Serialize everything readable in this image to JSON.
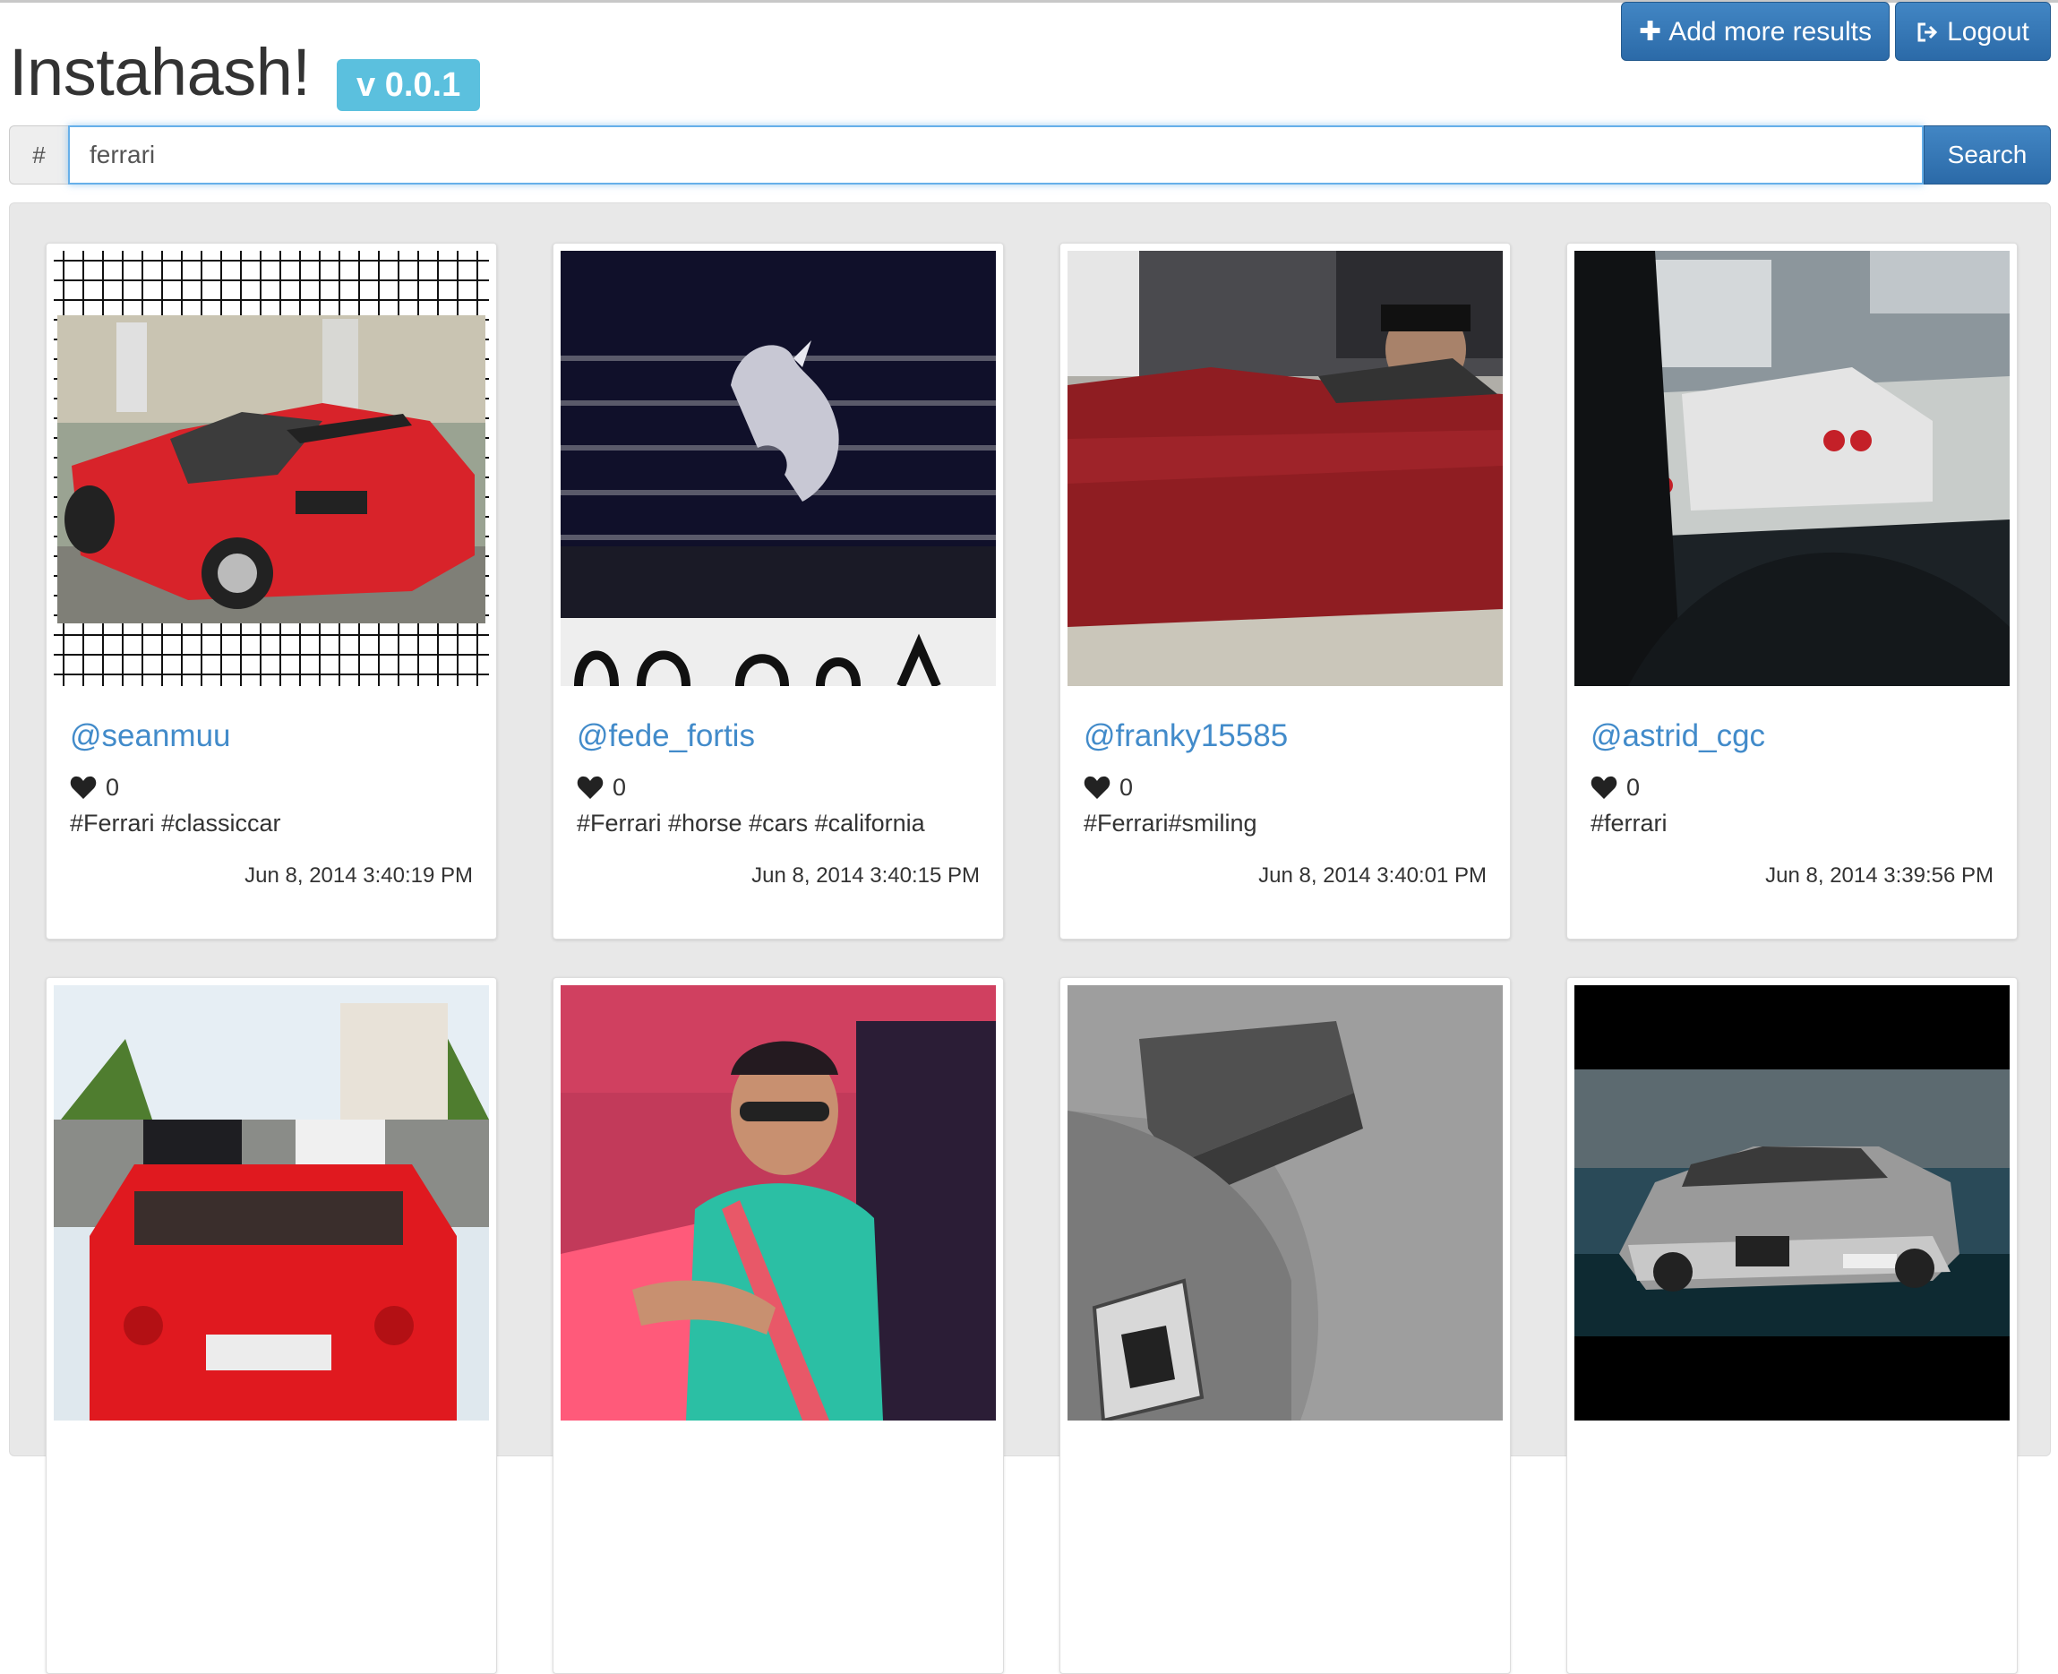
{
  "header": {
    "title": "Instahash!",
    "version": "v 0.0.1",
    "add_more_label": "Add more results",
    "logout_label": "Logout"
  },
  "search": {
    "prefix": "#",
    "value": "ferrari",
    "button_label": "Search"
  },
  "icons": {
    "add": "plus-icon",
    "logout": "sign-out-icon",
    "likes": "heart-icon"
  },
  "colors": {
    "primary": "#428bca",
    "badge": "#5bc0de",
    "link": "#428bca"
  },
  "posts": [
    {
      "user": "@seanmuu",
      "likes": "0",
      "tags": "#Ferrari #classiccar",
      "date": "Jun 8, 2014 3:40:19 PM"
    },
    {
      "user": "@fede_fortis",
      "likes": "0",
      "tags": "#Ferrari #horse #cars #california",
      "date": "Jun 8, 2014 3:40:15 PM"
    },
    {
      "user": "@franky15585",
      "likes": "0",
      "tags": "#Ferrari#smiling",
      "date": "Jun 8, 2014 3:40:01 PM"
    },
    {
      "user": "@astrid_cgc",
      "likes": "0",
      "tags": "#ferrari",
      "date": "Jun 8, 2014 3:39:56 PM"
    },
    {
      "user": "",
      "likes": "",
      "tags": "",
      "date": ""
    },
    {
      "user": "",
      "likes": "",
      "tags": "",
      "date": ""
    },
    {
      "user": "",
      "likes": "",
      "tags": "",
      "date": ""
    },
    {
      "user": "",
      "likes": "",
      "tags": "",
      "date": ""
    }
  ]
}
